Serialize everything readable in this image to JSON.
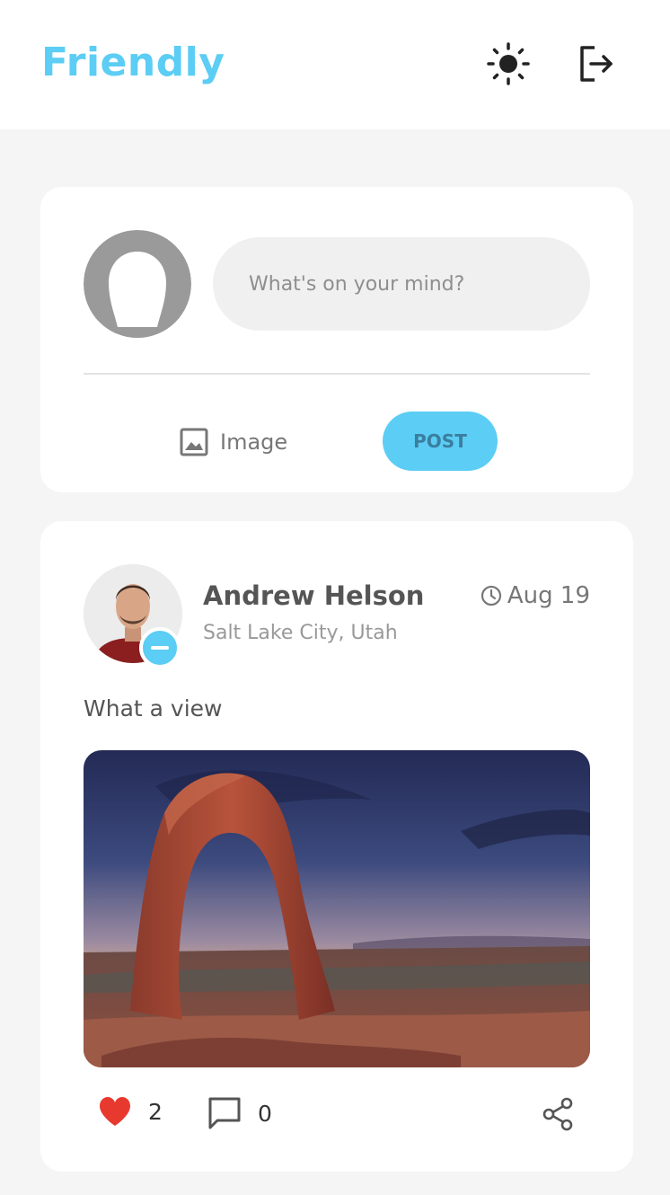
{
  "app": {
    "title": "Friendly"
  },
  "header": {
    "theme_icon": "sun-icon",
    "logout_icon": "logout-icon"
  },
  "composer": {
    "input_placeholder": "What's on your mind?",
    "image_label": "Image",
    "post_label": "POST"
  },
  "post": {
    "author_name": "Andrew Helson",
    "author_location": "Salt Lake City, Utah",
    "date": "Aug 19",
    "text": "What a view",
    "likes": "2",
    "comments": "0"
  },
  "colors": {
    "accent": "#5ccdf4",
    "like": "#e8392f",
    "background": "#f5f5f5"
  }
}
